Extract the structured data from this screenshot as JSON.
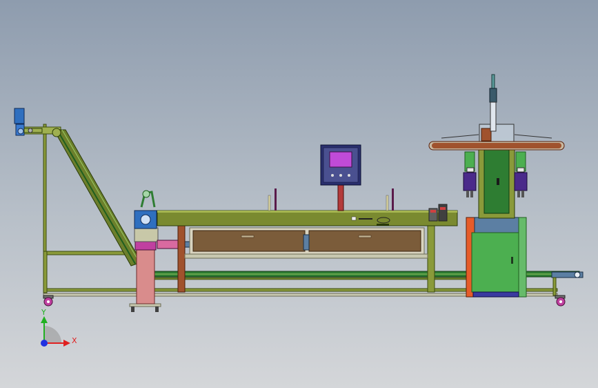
{
  "triad": {
    "x_label": "X",
    "y_label": "Y",
    "x_color": "#e02020",
    "y_color": "#20b020",
    "z_color": "#2030e0"
  },
  "colors": {
    "frame_olive": "#7a8a30",
    "frame_fill": "#8a9a3a",
    "conveyor_green": "#2e7d32",
    "drawer_brown": "#7b5c3a",
    "cabinet_green": "#4caf50",
    "cabinet_blue": "#5c7fa3",
    "cabinet_orange": "#e65c2a",
    "panel_navy": "#2a2f6e",
    "screen_magenta": "#c04bd8",
    "column_red": "#b33a3a",
    "pedestal_pink": "#d98c8c",
    "motor_blue": "#2f6fbf",
    "caster_magenta": "#c040a0",
    "arm_rust": "#a0522d"
  },
  "icons": [
    "motor-icon",
    "caster-icon",
    "touch-screen-icon",
    "cylinder-icon"
  ]
}
